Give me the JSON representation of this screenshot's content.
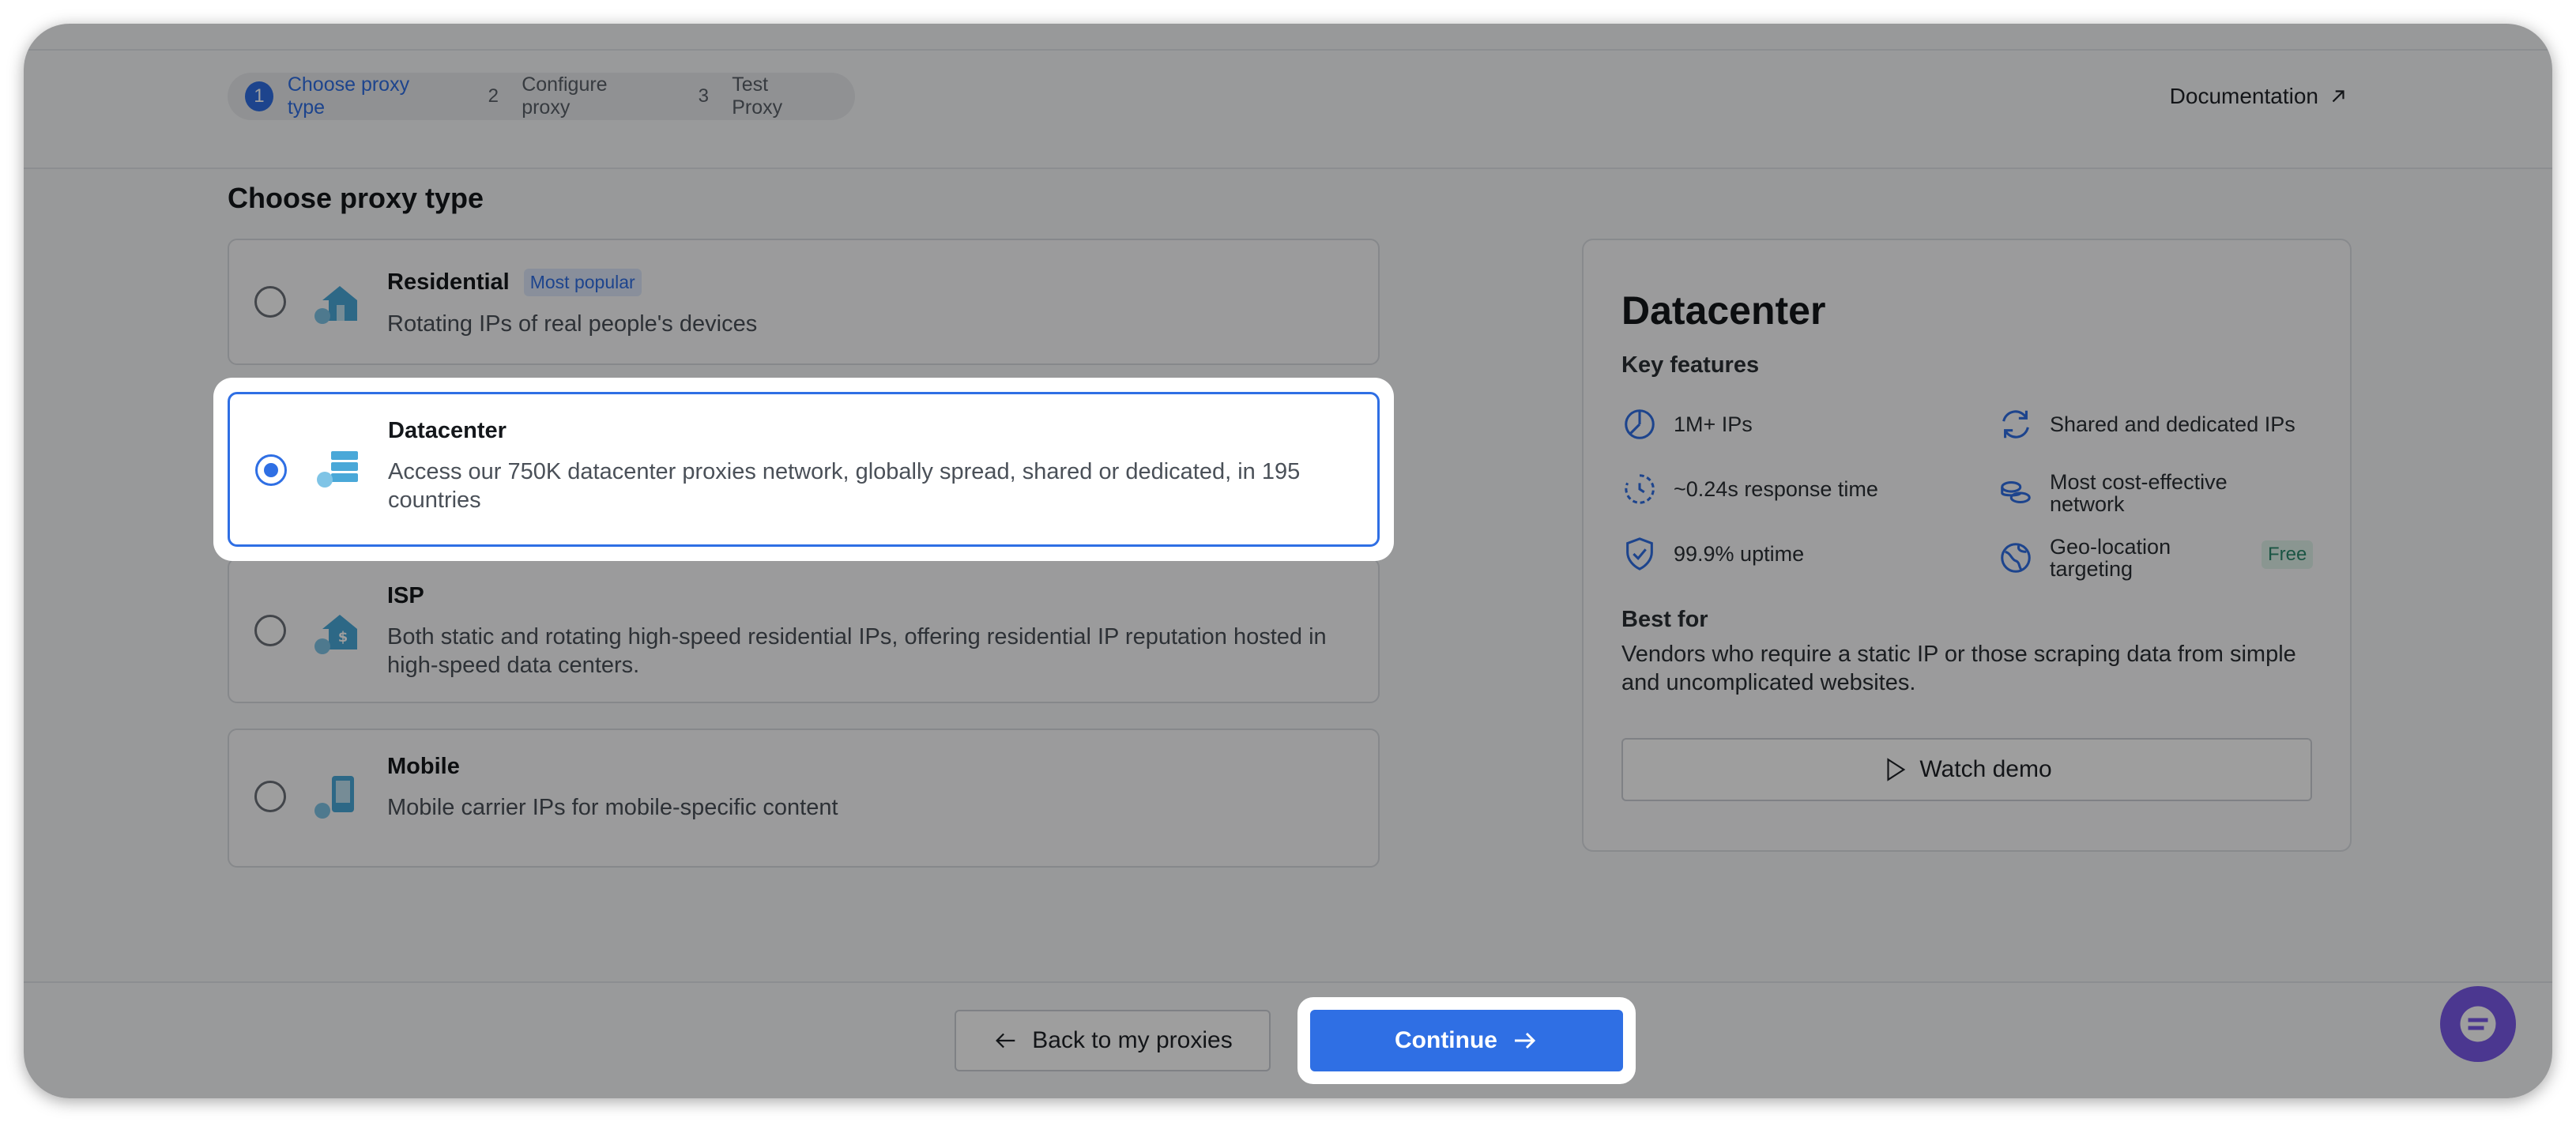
{
  "stepper": {
    "steps": [
      {
        "num": "1",
        "label": "Choose proxy type"
      },
      {
        "num": "2",
        "label": "Configure proxy"
      },
      {
        "num": "3",
        "label": "Test Proxy"
      }
    ],
    "active_index": 0
  },
  "header": {
    "documentation_label": "Documentation"
  },
  "section_title": "Choose proxy type",
  "proxy_types": [
    {
      "title": "Residential",
      "badge": "Most popular",
      "desc": "Rotating IPs of real people's devices",
      "icon": "residential-house-icon"
    },
    {
      "title": "Datacenter",
      "desc": "Access our 750K datacenter proxies network, globally spread, shared or dedicated, in 195 countries",
      "icon": "datacenter-server-icon"
    },
    {
      "title": "ISP",
      "desc": "Both static and rotating high-speed residential IPs, offering residential IP reputation hosted in high-speed data centers.",
      "icon": "isp-house-dollar-icon"
    },
    {
      "title": "Mobile",
      "desc": "Mobile carrier IPs for mobile-specific content",
      "icon": "mobile-phone-icon"
    }
  ],
  "selected_proxy_type": "Datacenter",
  "panel": {
    "title": "Datacenter",
    "key_features_label": "Key features",
    "features": [
      {
        "label": "1M+ IPs",
        "icon": "pie-chart-icon"
      },
      {
        "label": "Shared and dedicated IPs",
        "icon": "refresh-arrows-icon"
      },
      {
        "label": "~0.24s response time",
        "icon": "timer-icon"
      },
      {
        "label": "Most cost-effective network",
        "icon": "coins-icon"
      },
      {
        "label": "99.9% uptime",
        "icon": "shield-check-icon"
      },
      {
        "label": "Geo-location targeting",
        "icon": "globe-icon",
        "badge": "Free"
      }
    ],
    "best_for_label": "Best for",
    "best_for_desc": "Vendors who require a static IP or those scraping data from simple and uncomplicated websites.",
    "watch_demo_label": "Watch demo"
  },
  "footer": {
    "back_label": "Back to my proxies",
    "continue_label": "Continue"
  },
  "colors": {
    "accent": "#2f6fe4",
    "icon_blue": "#4aa8d8",
    "free_badge": "#2d8a6e",
    "chat": "#7a59e8"
  }
}
